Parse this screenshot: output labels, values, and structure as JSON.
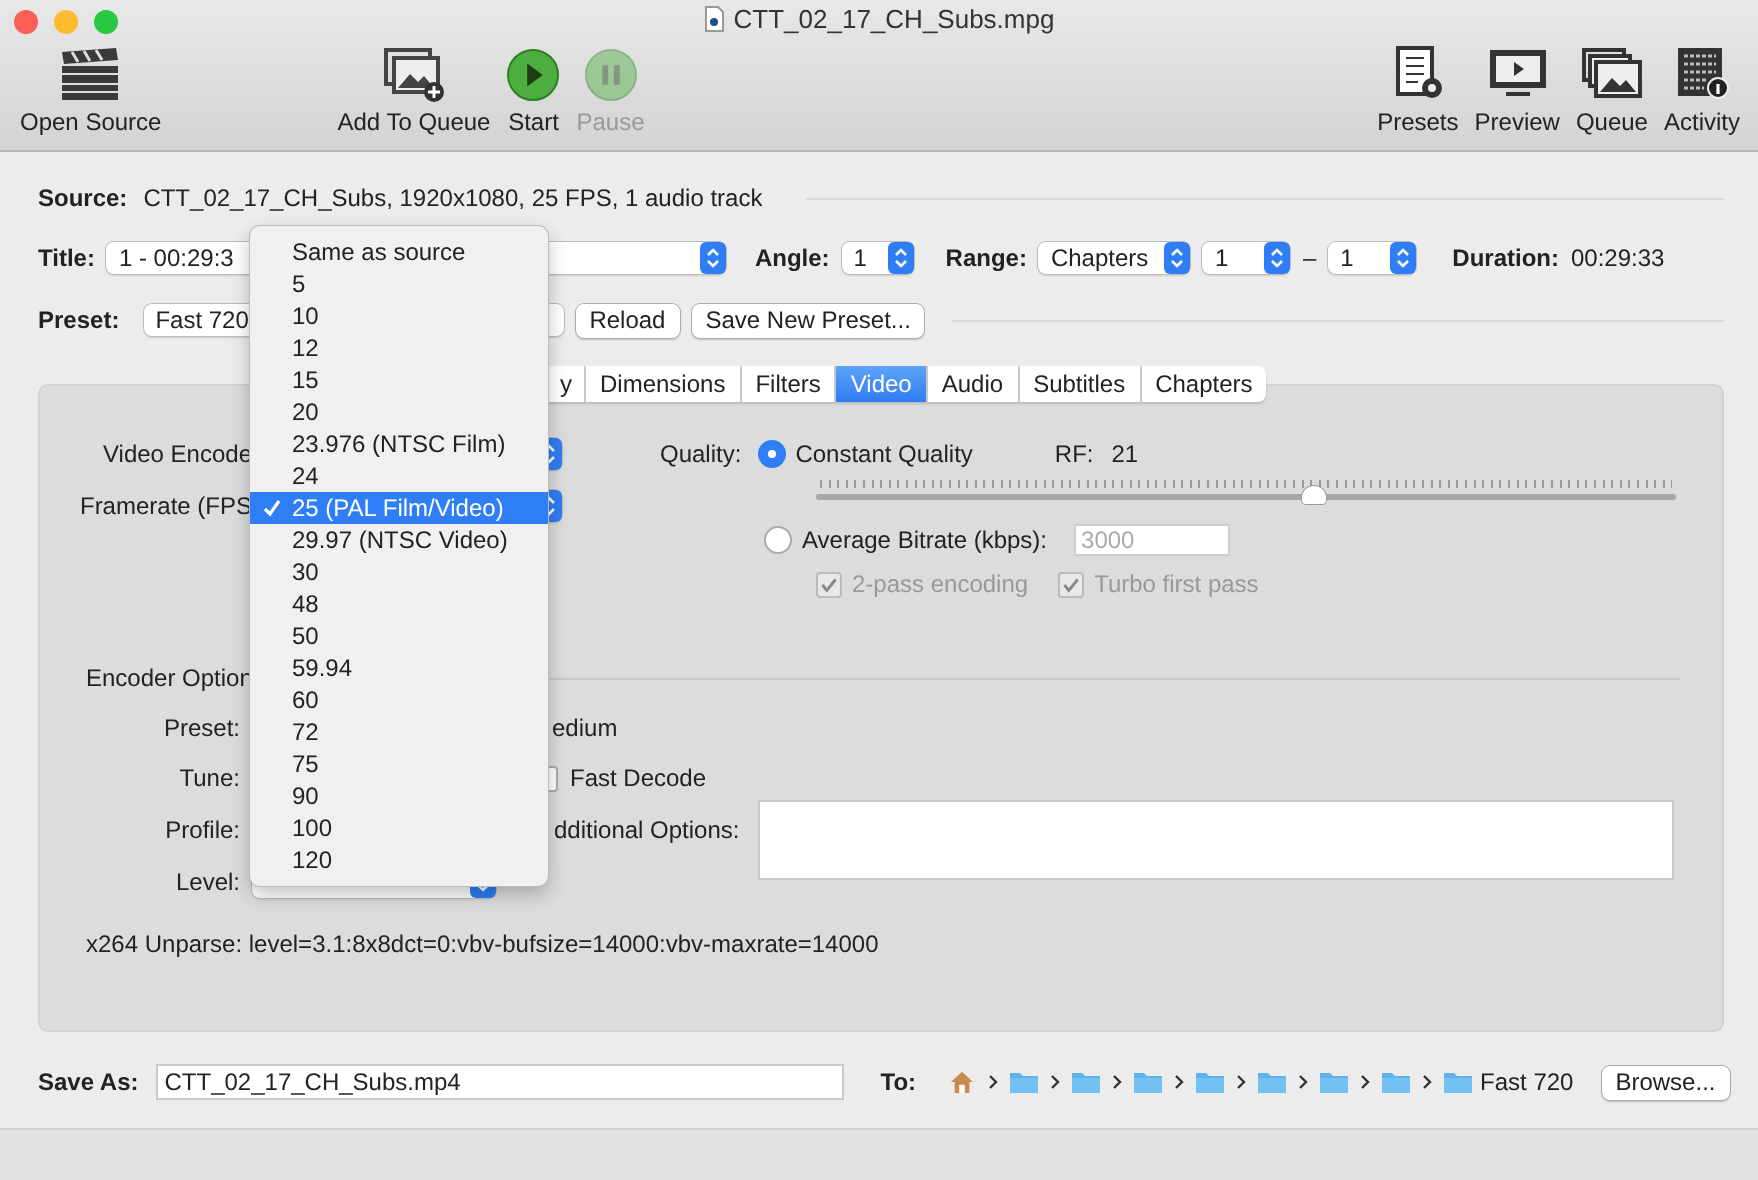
{
  "window": {
    "title": "CTT_02_17_CH_Subs.mpg"
  },
  "toolbar": {
    "left": [
      {
        "label": "Open Source",
        "disabled": false
      },
      {
        "label": "Add To Queue",
        "disabled": false
      },
      {
        "label": "Start",
        "disabled": false
      },
      {
        "label": "Pause",
        "disabled": true
      }
    ],
    "right": [
      {
        "label": "Presets"
      },
      {
        "label": "Preview"
      },
      {
        "label": "Queue"
      },
      {
        "label": "Activity"
      }
    ]
  },
  "source": {
    "label": "Source:",
    "value": "CTT_02_17_CH_Subs, 1920x1080, 25 FPS, 1 audio track"
  },
  "title_row": {
    "title_label": "Title:",
    "title_value": "1 - 00:29:3",
    "angle_label": "Angle:",
    "angle_value": "1",
    "range_label": "Range:",
    "range_value": "Chapters",
    "range_start": "1",
    "range_separator": "–",
    "range_end": "1",
    "duration_label": "Duration:",
    "duration_value": "00:29:33"
  },
  "preset_row": {
    "label": "Preset:",
    "value": "Fast 720",
    "buttons": [
      "Reload",
      "Save New Preset..."
    ]
  },
  "tabs": [
    {
      "label": "y",
      "selected": false
    },
    {
      "label": "Dimensions",
      "selected": false
    },
    {
      "label": "Filters",
      "selected": false
    },
    {
      "label": "Video",
      "selected": true
    },
    {
      "label": "Audio",
      "selected": false
    },
    {
      "label": "Subtitles",
      "selected": false
    },
    {
      "label": "Chapters",
      "selected": false
    }
  ],
  "video": {
    "encoder_label": "Video Encode",
    "framerate_label": "Framerate (FPS",
    "quality": {
      "label": "Quality:",
      "rf_label": "RF:",
      "rf_value": "21",
      "level": 0.58,
      "options": [
        {
          "label": "Constant Quality",
          "selected": true
        },
        {
          "label": "Average Bitrate (kbps):",
          "selected": false
        }
      ],
      "bitrate": {
        "value": "3000",
        "disabled": true
      },
      "checkboxes": [
        {
          "label": "2-pass encoding",
          "checked": true,
          "disabled": true
        },
        {
          "label": "Turbo first pass",
          "checked": true,
          "disabled": true
        }
      ]
    },
    "encoder_options": {
      "title": "Encoder Option",
      "preset_label": "Preset:",
      "preset_value": "edium",
      "tune_label": "Tune:",
      "fast_decode": {
        "label": "Fast Decode",
        "checked": false
      },
      "profile_label": "Profile:",
      "additional_label": "dditional Options:",
      "level_label": "Level:"
    },
    "unparse": "x264 Unparse: level=3.1:8x8dct=0:vbv-bufsize=14000:vbv-maxrate=14000"
  },
  "save": {
    "label": "Save As:",
    "value": "CTT_02_17_CH_Subs.mp4",
    "to_label": "To:",
    "path": [
      {
        "kind": "home"
      },
      {
        "kind": "folder"
      },
      {
        "kind": "folder"
      },
      {
        "kind": "folder"
      },
      {
        "kind": "folder"
      },
      {
        "kind": "folder"
      },
      {
        "kind": "folder"
      },
      {
        "kind": "folder"
      },
      {
        "kind": "folder",
        "label": "Fast 720"
      }
    ],
    "browse": "Browse..."
  },
  "menu": {
    "items": [
      {
        "label": "Same as source",
        "selected": false
      },
      {
        "label": "5",
        "selected": false
      },
      {
        "label": "10",
        "selected": false
      },
      {
        "label": "12",
        "selected": false
      },
      {
        "label": "15",
        "selected": false
      },
      {
        "label": "20",
        "selected": false
      },
      {
        "label": "23.976 (NTSC Film)",
        "selected": false
      },
      {
        "label": "24",
        "selected": false
      },
      {
        "label": "25 (PAL Film/Video)",
        "selected": true
      },
      {
        "label": "29.97 (NTSC Video)",
        "selected": false
      },
      {
        "label": "30",
        "selected": false
      },
      {
        "label": "48",
        "selected": false
      },
      {
        "label": "50",
        "selected": false
      },
      {
        "label": "59.94",
        "selected": false
      },
      {
        "label": "60",
        "selected": false
      },
      {
        "label": "72",
        "selected": false
      },
      {
        "label": "75",
        "selected": false
      },
      {
        "label": "90",
        "selected": false
      },
      {
        "label": "100",
        "selected": false
      },
      {
        "label": "120",
        "selected": false
      }
    ]
  }
}
